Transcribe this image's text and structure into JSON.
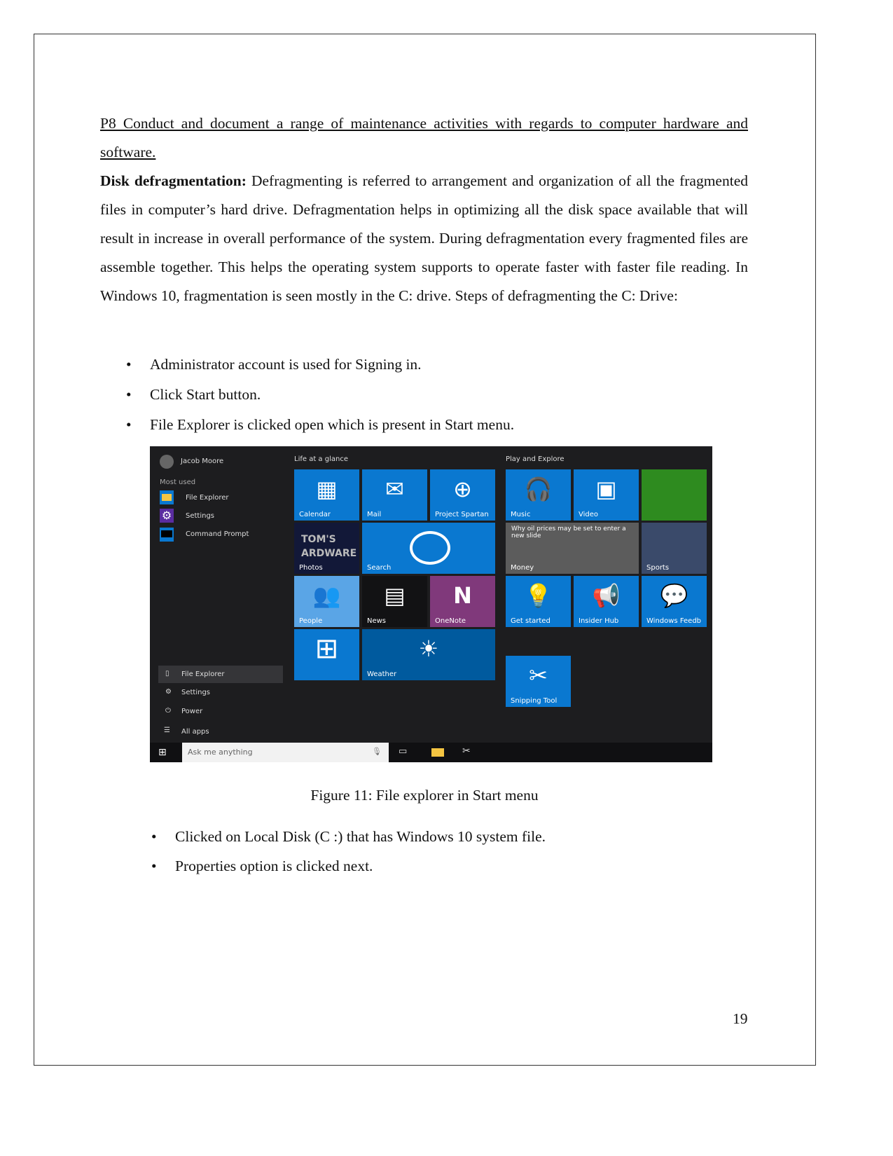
{
  "heading": "P8 Conduct and document a range of maintenance activities with regards to computer hardware and software.",
  "section": {
    "label": "Disk defragmentation:",
    "text": " Defragmenting is referred to arrangement and organization of all the fragmented files in computer’s hard drive. Defragmentation helps in optimizing all the disk space available that will result in increase in overall performance of the system. During defragmentation every fragmented files are assemble together. This helps the operating system supports to operate faster with faster file reading. In Windows 10, fragmentation is seen mostly in the C: drive. Steps of defragmenting the C: Drive:"
  },
  "bullets1": [
    "Administrator account is used for Signing in.",
    "Click Start button.",
    "File Explorer is clicked open which is present in Start menu."
  ],
  "screenshot": {
    "user": "Jacob Moore",
    "most_used_label": "Most used",
    "most_used": [
      "File Explorer",
      "Settings",
      "Command Prompt"
    ],
    "bottom_items": [
      "File Explorer",
      "Settings",
      "Power",
      "All apps"
    ],
    "group1": "Life at a glance",
    "group2": "Play and Explore",
    "tiles": {
      "calendar": "Calendar",
      "mail": "Mail",
      "spartan": "Project Spartan",
      "photos_brand": "TOM'S ARDWARE",
      "photos": "Photos",
      "search": "Search",
      "people": "People",
      "news": "News",
      "onenote": "OneNote",
      "weather": "Weather",
      "music": "Music",
      "video": "Video",
      "money_headline": "Why oil prices may be set to enter a new slide",
      "money": "Money",
      "sports": "Sports",
      "get_started": "Get started",
      "insider": "Insider Hub",
      "feedback": "Windows Feedb",
      "snipping": "Snipping Tool"
    },
    "search_placeholder": "Ask me anything"
  },
  "caption": "Figure 11: File explorer in Start menu",
  "bullets2": [
    "Clicked on Local Disk (C :) that has Windows 10 system file.",
    "Properties option is clicked next."
  ],
  "page_number": "19"
}
